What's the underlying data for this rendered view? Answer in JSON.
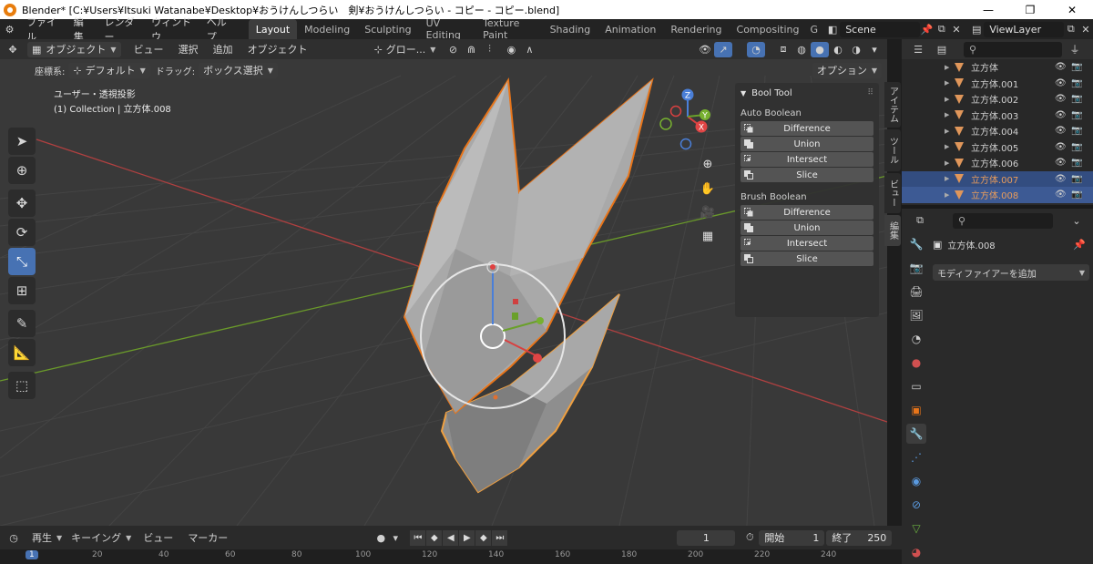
{
  "window": {
    "title": "Blender* [C:¥Users¥Itsuki Watanabe¥Desktop¥おうけんしつらい　剣¥おうけんしつらい - コピー - コピー.blend]",
    "minimize": "—",
    "maximize": "❐",
    "close": "✕"
  },
  "menu": [
    "ファイル",
    "編集",
    "レンダー",
    "ウィンドウ",
    "ヘルプ"
  ],
  "workspaces": [
    "Layout",
    "Modeling",
    "Sculpting",
    "UV Editing",
    "Texture Paint",
    "Shading",
    "Animation",
    "Rendering",
    "Compositing",
    "G"
  ],
  "active_workspace": "Layout",
  "scene": "Scene",
  "view_layer": "ViewLayer",
  "viewport": {
    "mode": "オブジェクト",
    "menus": [
      "ビュー",
      "選択",
      "追加",
      "オブジェクト"
    ],
    "transform_orientation": "グロー...",
    "coord_label": "座標系:",
    "coord_value": "デフォルト",
    "drag_label": "ドラッグ:",
    "drag_value": "ボックス選択",
    "options": "オプション",
    "view_name": "ユーザー・透視投影",
    "collection_info": "(1) Collection | 立方体.008"
  },
  "gizmo": {
    "x": "X",
    "y": "Y",
    "z": "Z"
  },
  "npanel": {
    "title": "Bool Tool",
    "auto_section": "Auto Boolean",
    "auto_buttons": [
      "Difference",
      "Union",
      "Intersect",
      "Slice"
    ],
    "brush_section": "Brush Boolean",
    "brush_buttons": [
      "Difference",
      "Union",
      "Intersect",
      "Slice"
    ],
    "tabs": [
      "アイテム",
      "ツール",
      "ビュー",
      "編集"
    ]
  },
  "timeline": {
    "playback": "再生",
    "keying": "キーイング",
    "view": "ビュー",
    "marker": "マーカー",
    "current_frame": "1",
    "start_label": "開始",
    "start": "1",
    "end_label": "終了",
    "end": "250",
    "ticks": [
      "1",
      "20",
      "40",
      "60",
      "80",
      "100",
      "120",
      "140",
      "160",
      "180",
      "200",
      "220",
      "240"
    ]
  },
  "outliner": {
    "items": [
      {
        "name": "立方体",
        "state": "normal"
      },
      {
        "name": "立方体.001",
        "state": "normal"
      },
      {
        "name": "立方体.002",
        "state": "normal"
      },
      {
        "name": "立方体.003",
        "state": "normal"
      },
      {
        "name": "立方体.004",
        "state": "normal"
      },
      {
        "name": "立方体.005",
        "state": "normal"
      },
      {
        "name": "立方体.006",
        "state": "normal"
      },
      {
        "name": "立方体.007",
        "state": "selected"
      },
      {
        "name": "立方体.008",
        "state": "active"
      }
    ]
  },
  "properties": {
    "object_name": "立方体.008",
    "add_modifier": "モディファイアーを追加"
  },
  "colors": {
    "accent": "#4772b3",
    "selection_orange": "#e8751a",
    "active_outline": "#f0a040",
    "x_axis": "#d54040",
    "y_axis": "#6aa02a"
  }
}
